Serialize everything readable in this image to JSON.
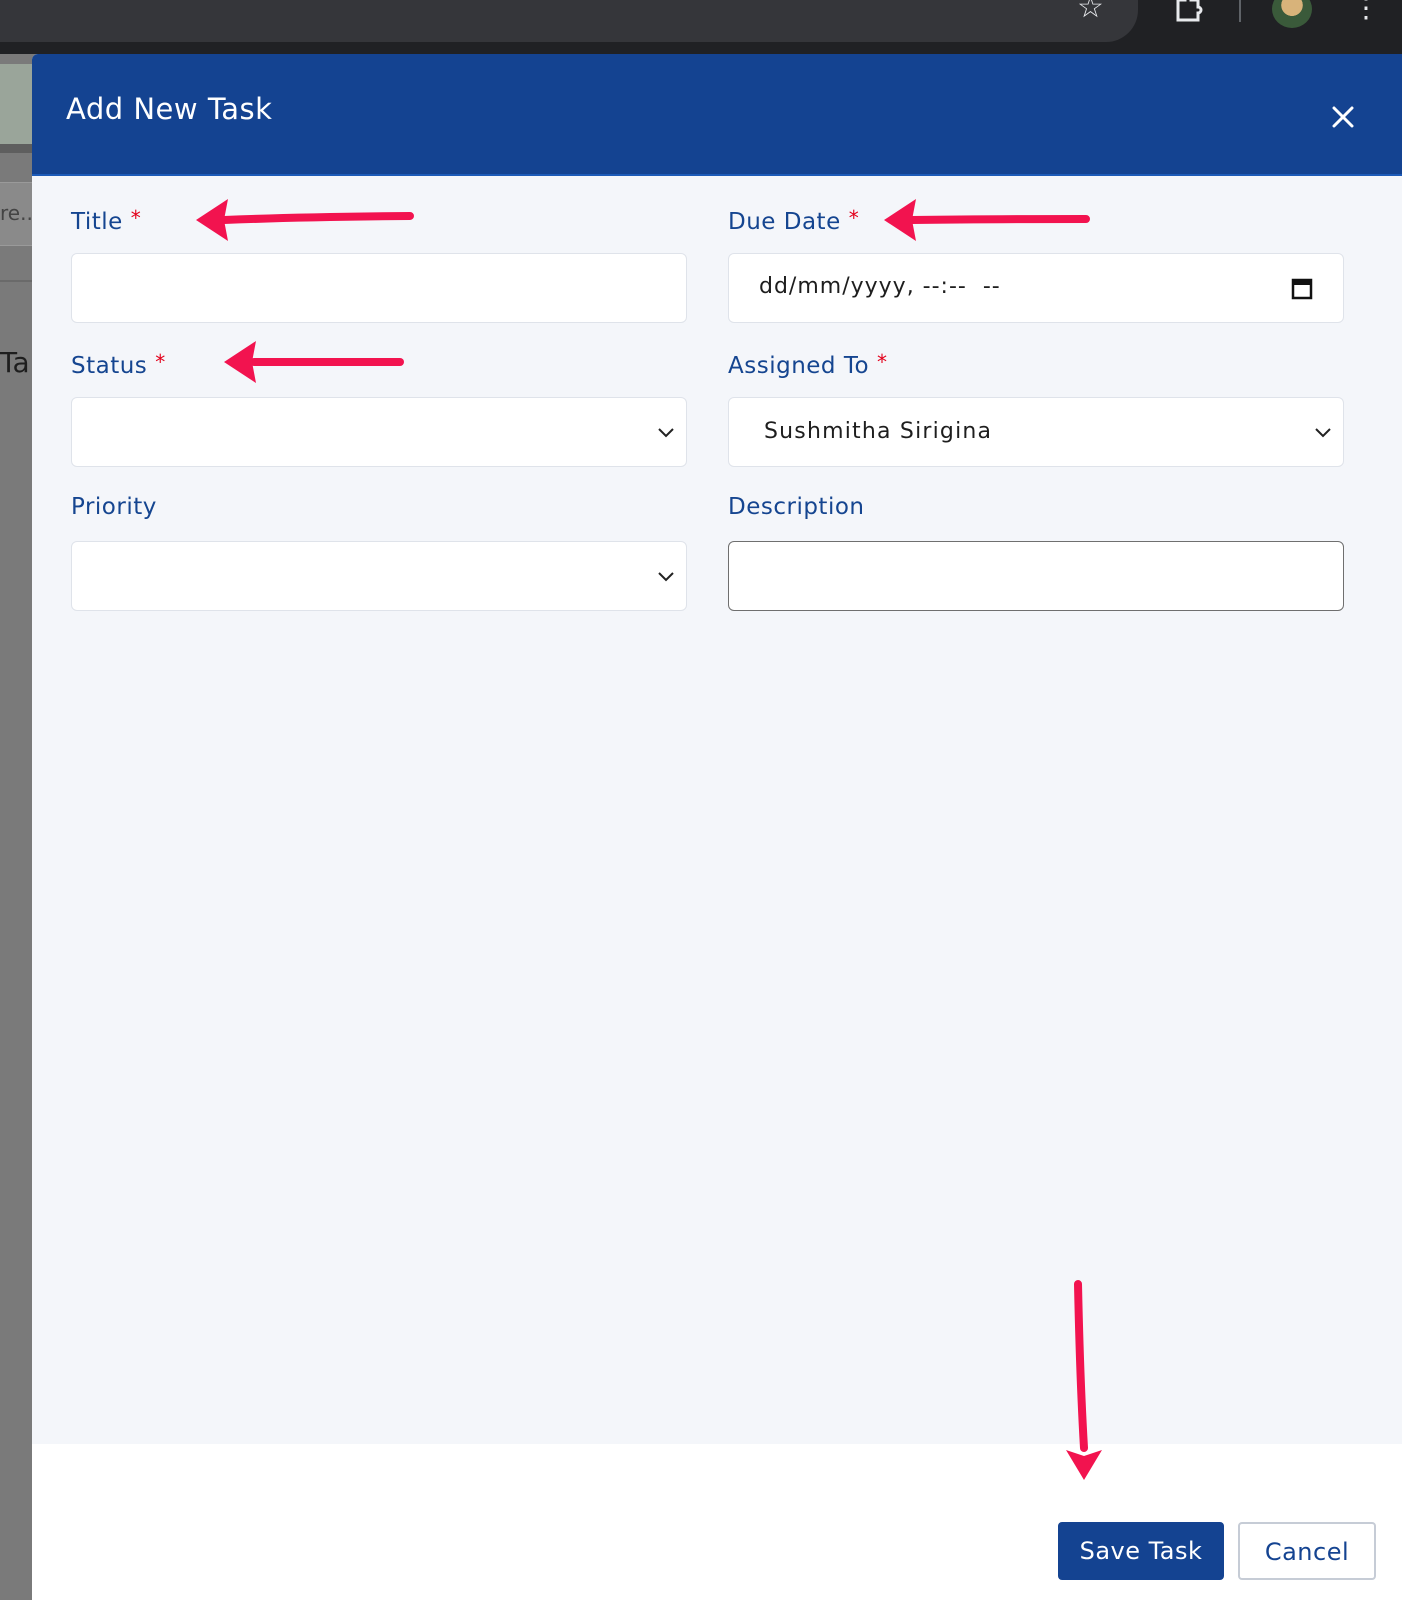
{
  "browser": {
    "icons": [
      "star-icon",
      "puzzle-extension-icon",
      "profile-avatar",
      "kebab-menu-icon"
    ]
  },
  "background_page": {
    "input_fragment": "re..",
    "heading_fragment": "Ta"
  },
  "modal": {
    "title": "Add New Task",
    "close_icon": "close-icon",
    "header_color": "#144391",
    "fields": {
      "title": {
        "label": "Title",
        "required_mark": "*",
        "value": ""
      },
      "due_date": {
        "label": "Due Date",
        "required_mark": "*",
        "placeholder": "dd/mm/yyyy, --:--  --"
      },
      "status": {
        "label": "Status",
        "required_mark": "*",
        "selected": ""
      },
      "assigned_to": {
        "label": "Assigned To",
        "required_mark": "*",
        "selected": "Sushmitha Sirigina"
      },
      "priority": {
        "label": "Priority",
        "selected": ""
      },
      "description": {
        "label": "Description",
        "value": ""
      }
    },
    "footer": {
      "save_label": "Save Task",
      "cancel_label": "Cancel"
    }
  },
  "colors": {
    "label": "#154590",
    "required": "#e3001b",
    "annotation_arrow": "#f2134f"
  }
}
